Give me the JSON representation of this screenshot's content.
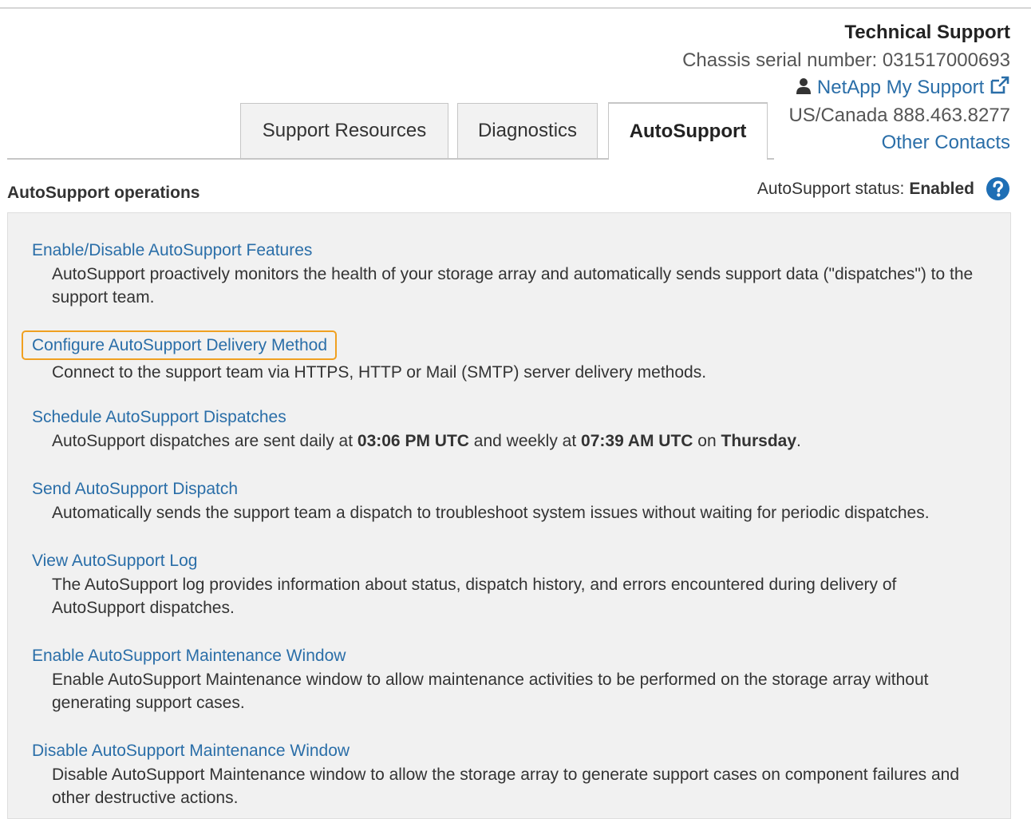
{
  "support": {
    "title": "Technical Support",
    "serial": "Chassis serial number: 031517000693",
    "my_support": "NetApp My Support",
    "phone": "US/Canada 888.463.8277",
    "other_contacts": "Other Contacts"
  },
  "tabs": [
    {
      "label": "Support Resources",
      "active": false
    },
    {
      "label": "Diagnostics",
      "active": false
    },
    {
      "label": "AutoSupport",
      "active": true
    }
  ],
  "operations": {
    "heading": "AutoSupport operations",
    "status_label": "AutoSupport status:",
    "status_value": "Enabled",
    "items": [
      {
        "link": "Enable/Disable AutoSupport Features",
        "desc": "AutoSupport proactively monitors the health of your storage array and automatically sends support data (\"dispatches\") to the support team."
      },
      {
        "link": "Configure AutoSupport Delivery Method",
        "highlighted": true,
        "desc": "Connect to the support team via HTTPS, HTTP or Mail (SMTP) server delivery methods."
      },
      {
        "link": "Schedule AutoSupport Dispatches",
        "desc_parts": [
          "AutoSupport dispatches are sent daily at ",
          "03:06 PM UTC",
          " and weekly at ",
          "07:39 AM UTC",
          " on ",
          "Thursday",
          "."
        ]
      },
      {
        "link": "Send AutoSupport Dispatch",
        "desc": "Automatically sends the support team a dispatch to troubleshoot system issues without waiting for periodic dispatches."
      },
      {
        "link": "View AutoSupport Log",
        "desc": "The AutoSupport log provides information about status, dispatch history, and errors encountered during delivery of AutoSupport dispatches."
      },
      {
        "link": "Enable AutoSupport Maintenance Window",
        "desc": "Enable AutoSupport Maintenance window to allow maintenance activities to be performed on the storage array without generating support cases."
      },
      {
        "link": "Disable AutoSupport Maintenance Window",
        "desc": "Disable AutoSupport Maintenance window to allow the storage array to generate support cases on component failures and other destructive actions."
      }
    ]
  },
  "icons": {
    "user": "user-icon",
    "external": "external-link-icon",
    "help": "help-icon"
  },
  "colors": {
    "link": "#2a6ea8",
    "highlight": "#f0a020",
    "help": "#1f6fb5"
  }
}
